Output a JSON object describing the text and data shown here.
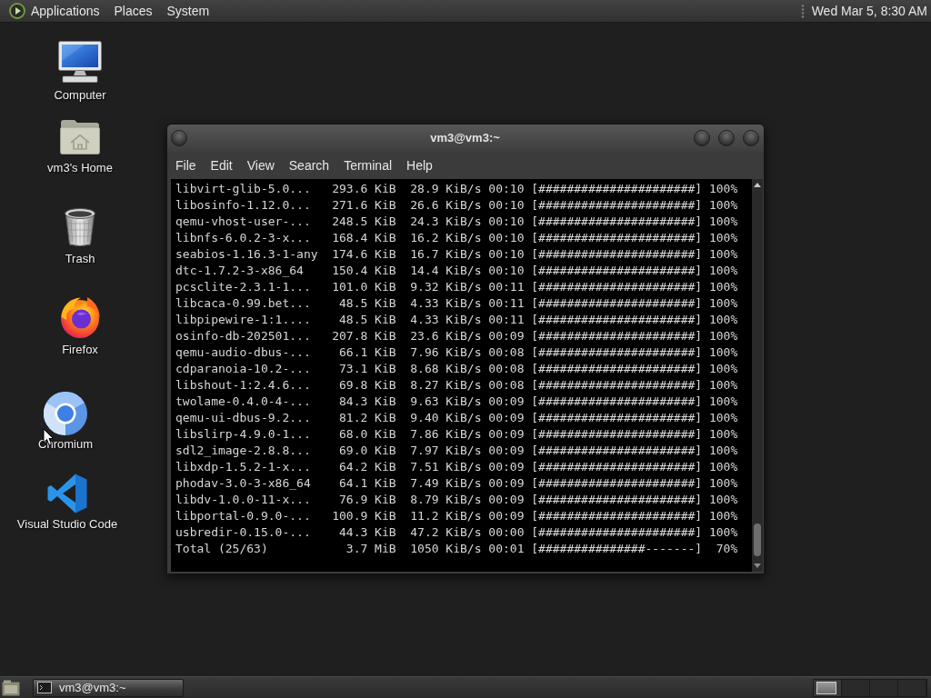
{
  "top_panel": {
    "menus": [
      "Applications",
      "Places",
      "System"
    ],
    "clock": "Wed Mar 5, 8:30 AM"
  },
  "desktop_icons": [
    {
      "kind": "computer",
      "label": "Computer"
    },
    {
      "kind": "home",
      "label": "vm3's Home"
    },
    {
      "kind": "trash",
      "label": "Trash"
    },
    {
      "kind": "firefox",
      "label": "Firefox"
    },
    {
      "kind": "chromium",
      "label": "Chromium"
    },
    {
      "kind": "vscode",
      "label": "Visual Studio Code"
    }
  ],
  "terminal": {
    "title": "vm3@vm3:~",
    "menu": [
      "File",
      "Edit",
      "View",
      "Search",
      "Terminal",
      "Help"
    ],
    "rows": [
      {
        "package": "libvirt-glib-5.0...",
        "size": "293.6 KiB",
        "rate": "28.9 KiB/s",
        "elapsed": "00:10",
        "bar": "[######################]",
        "percent": "100%"
      },
      {
        "package": "libosinfo-1.12.0...",
        "size": "271.6 KiB",
        "rate": "26.6 KiB/s",
        "elapsed": "00:10",
        "bar": "[######################]",
        "percent": "100%"
      },
      {
        "package": "qemu-vhost-user-...",
        "size": "248.5 KiB",
        "rate": "24.3 KiB/s",
        "elapsed": "00:10",
        "bar": "[######################]",
        "percent": "100%"
      },
      {
        "package": "libnfs-6.0.2-3-x...",
        "size": "168.4 KiB",
        "rate": "16.2 KiB/s",
        "elapsed": "00:10",
        "bar": "[######################]",
        "percent": "100%"
      },
      {
        "package": "seabios-1.16.3-1-any",
        "size": "174.6 KiB",
        "rate": "16.7 KiB/s",
        "elapsed": "00:10",
        "bar": "[######################]",
        "percent": "100%"
      },
      {
        "package": "dtc-1.7.2-3-x86_64",
        "size": "150.4 KiB",
        "rate": "14.4 KiB/s",
        "elapsed": "00:10",
        "bar": "[######################]",
        "percent": "100%"
      },
      {
        "package": "pcsclite-2.3.1-1...",
        "size": "101.0 KiB",
        "rate": "9.32 KiB/s",
        "elapsed": "00:11",
        "bar": "[######################]",
        "percent": "100%"
      },
      {
        "package": "libcaca-0.99.bet...",
        "size": "48.5 KiB",
        "rate": "4.33 KiB/s",
        "elapsed": "00:11",
        "bar": "[######################]",
        "percent": "100%"
      },
      {
        "package": "libpipewire-1:1....",
        "size": "48.5 KiB",
        "rate": "4.33 KiB/s",
        "elapsed": "00:11",
        "bar": "[######################]",
        "percent": "100%"
      },
      {
        "package": "osinfo-db-202501...",
        "size": "207.8 KiB",
        "rate": "23.6 KiB/s",
        "elapsed": "00:09",
        "bar": "[######################]",
        "percent": "100%"
      },
      {
        "package": "qemu-audio-dbus-...",
        "size": "66.1 KiB",
        "rate": "7.96 KiB/s",
        "elapsed": "00:08",
        "bar": "[######################]",
        "percent": "100%"
      },
      {
        "package": "cdparanoia-10.2-...",
        "size": "73.1 KiB",
        "rate": "8.68 KiB/s",
        "elapsed": "00:08",
        "bar": "[######################]",
        "percent": "100%"
      },
      {
        "package": "libshout-1:2.4.6...",
        "size": "69.8 KiB",
        "rate": "8.27 KiB/s",
        "elapsed": "00:08",
        "bar": "[######################]",
        "percent": "100%"
      },
      {
        "package": "twolame-0.4.0-4-...",
        "size": "84.3 KiB",
        "rate": "9.63 KiB/s",
        "elapsed": "00:09",
        "bar": "[######################]",
        "percent": "100%"
      },
      {
        "package": "qemu-ui-dbus-9.2...",
        "size": "81.2 KiB",
        "rate": "9.40 KiB/s",
        "elapsed": "00:09",
        "bar": "[######################]",
        "percent": "100%"
      },
      {
        "package": "libslirp-4.9.0-1...",
        "size": "68.0 KiB",
        "rate": "7.86 KiB/s",
        "elapsed": "00:09",
        "bar": "[######################]",
        "percent": "100%"
      },
      {
        "package": "sdl2_image-2.8.8...",
        "size": "69.0 KiB",
        "rate": "7.97 KiB/s",
        "elapsed": "00:09",
        "bar": "[######################]",
        "percent": "100%"
      },
      {
        "package": "libxdp-1.5.2-1-x...",
        "size": "64.2 KiB",
        "rate": "7.51 KiB/s",
        "elapsed": "00:09",
        "bar": "[######################]",
        "percent": "100%"
      },
      {
        "package": "phodav-3.0-3-x86_64",
        "size": "64.1 KiB",
        "rate": "7.49 KiB/s",
        "elapsed": "00:09",
        "bar": "[######################]",
        "percent": "100%"
      },
      {
        "package": "libdv-1.0.0-11-x...",
        "size": "76.9 KiB",
        "rate": "8.79 KiB/s",
        "elapsed": "00:09",
        "bar": "[######################]",
        "percent": "100%"
      },
      {
        "package": "libportal-0.9.0-...",
        "size": "100.9 KiB",
        "rate": "11.2 KiB/s",
        "elapsed": "00:09",
        "bar": "[######################]",
        "percent": "100%"
      },
      {
        "package": "usbredir-0.15.0-...",
        "size": "44.3 KiB",
        "rate": "47.2 KiB/s",
        "elapsed": "00:00",
        "bar": "[######################]",
        "percent": "100%"
      },
      {
        "package": "Total (25/63)",
        "size": "3.7 MiB",
        "rate": "1050 KiB/s",
        "elapsed": "00:01",
        "bar": "[###############-------]",
        "percent": "70%"
      }
    ]
  },
  "taskbar": {
    "tasks": [
      {
        "label": "vm3@vm3:~",
        "selected": true
      }
    ],
    "workspaces": [
      {
        "selected": true
      },
      {
        "selected": false
      },
      {
        "selected": false
      },
      {
        "selected": false
      }
    ]
  }
}
